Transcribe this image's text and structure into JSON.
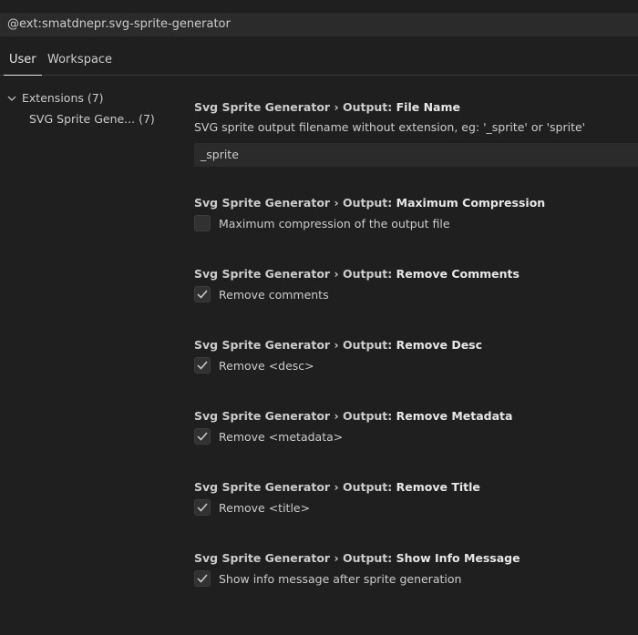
{
  "search": {
    "value": "@ext:smatdnepr.svg-sprite-generator"
  },
  "tabs": [
    {
      "label": "User",
      "active": true
    },
    {
      "label": "Workspace",
      "active": false
    }
  ],
  "toc": {
    "group_label": "Extensions (7)",
    "sub_label": "SVG Sprite Gene... (7)"
  },
  "settings": [
    {
      "category": "Svg Sprite Generator › Output: ",
      "key": "File Name",
      "type": "text",
      "description": "SVG sprite output filename without extension, eg: '_sprite' or 'sprite'",
      "value": "_sprite"
    },
    {
      "category": "Svg Sprite Generator › Output: ",
      "key": "Maximum Compression",
      "type": "checkbox",
      "label": "Maximum compression of the output file",
      "checked": false
    },
    {
      "category": "Svg Sprite Generator › Output: ",
      "key": "Remove Comments",
      "type": "checkbox",
      "label": "Remove comments",
      "checked": true
    },
    {
      "category": "Svg Sprite Generator › Output: ",
      "key": "Remove Desc",
      "type": "checkbox",
      "label": "Remove <desc>",
      "checked": true
    },
    {
      "category": "Svg Sprite Generator › Output: ",
      "key": "Remove Metadata",
      "type": "checkbox",
      "label": "Remove <metadata>",
      "checked": true
    },
    {
      "category": "Svg Sprite Generator › Output: ",
      "key": "Remove Title",
      "type": "checkbox",
      "label": "Remove <title>",
      "checked": true
    },
    {
      "category": "Svg Sprite Generator › Output: ",
      "key": "Show Info Message",
      "type": "checkbox",
      "label": "Show info message after sprite generation",
      "checked": true
    }
  ],
  "icons": {
    "chevron": "chevron-down-icon",
    "check": "check-icon"
  }
}
